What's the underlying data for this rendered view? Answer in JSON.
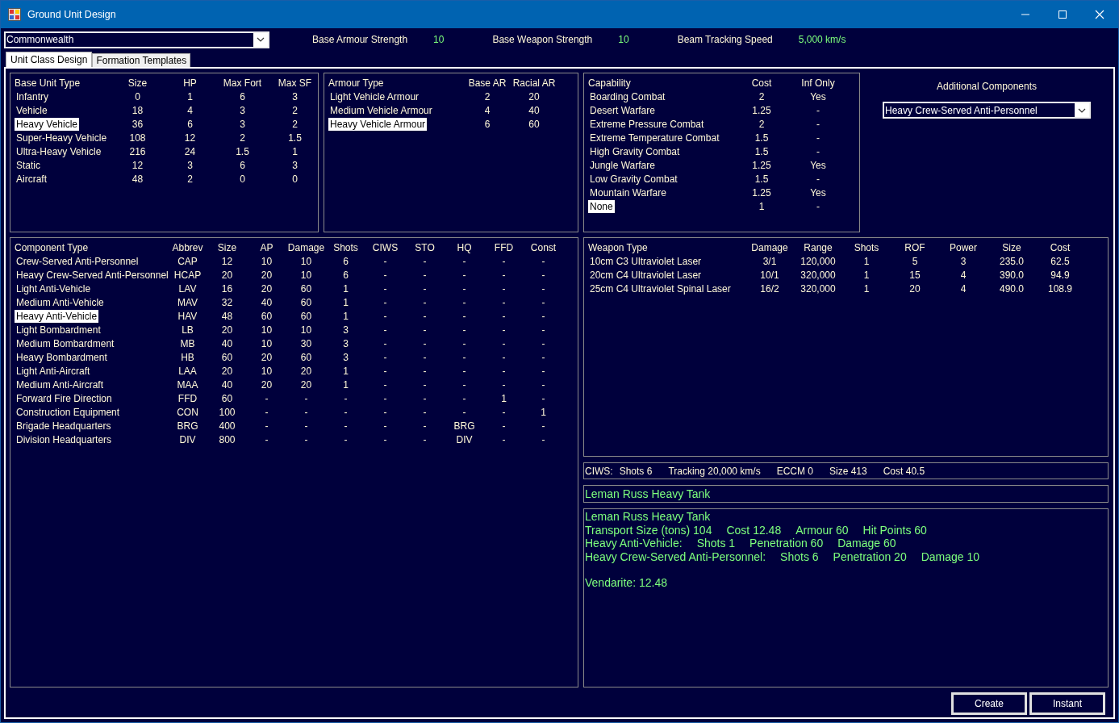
{
  "window": {
    "title": "Ground Unit Design"
  },
  "empire_select": {
    "value": "Commonwealth"
  },
  "stats": [
    {
      "label": "Base Armour Strength",
      "value": "10"
    },
    {
      "label": "Base Weapon Strength",
      "value": "10"
    },
    {
      "label": "Beam Tracking Speed",
      "value": "5,000 km/s"
    }
  ],
  "tabs": [
    {
      "label": "Unit Class Design",
      "selected": true
    },
    {
      "label": "Formation Templates",
      "selected": false
    }
  ],
  "base_unit_table": {
    "columns": [
      "Base Unit Type",
      "Size",
      "HP",
      "Max Fort",
      "Max SF"
    ],
    "rows": [
      {
        "cells": [
          "Infantry",
          "0",
          "1",
          "6",
          "3"
        ],
        "selected": false
      },
      {
        "cells": [
          "Vehicle",
          "18",
          "4",
          "3",
          "2"
        ],
        "selected": false
      },
      {
        "cells": [
          "Heavy Vehicle",
          "36",
          "6",
          "3",
          "2"
        ],
        "selected": true
      },
      {
        "cells": [
          "Super-Heavy Vehicle",
          "108",
          "12",
          "2",
          "1.5"
        ],
        "selected": false
      },
      {
        "cells": [
          "Ultra-Heavy Vehicle",
          "216",
          "24",
          "1.5",
          "1"
        ],
        "selected": false
      },
      {
        "cells": [
          "Static",
          "12",
          "3",
          "6",
          "3"
        ],
        "selected": false
      },
      {
        "cells": [
          "Aircraft",
          "48",
          "2",
          "0",
          "0"
        ],
        "selected": false
      }
    ]
  },
  "armour_table": {
    "columns": [
      "Armour Type",
      "Base AR",
      "Racial AR"
    ],
    "rows": [
      {
        "cells": [
          "Light Vehicle Armour",
          "2",
          "20"
        ],
        "selected": false
      },
      {
        "cells": [
          "Medium Vehicle Armour",
          "4",
          "40"
        ],
        "selected": false
      },
      {
        "cells": [
          "Heavy Vehicle Armour",
          "6",
          "60"
        ],
        "selected": true
      }
    ]
  },
  "capability_table": {
    "columns": [
      "Capability",
      "Cost",
      "Inf Only"
    ],
    "rows": [
      {
        "cells": [
          "Boarding Combat",
          "2",
          "Yes"
        ],
        "selected": false
      },
      {
        "cells": [
          "Desert Warfare",
          "1.25",
          "-"
        ],
        "selected": false
      },
      {
        "cells": [
          "Extreme Pressure Combat",
          "2",
          "-"
        ],
        "selected": false
      },
      {
        "cells": [
          "Extreme Temperature Combat",
          "1.5",
          "-"
        ],
        "selected": false
      },
      {
        "cells": [
          "High Gravity Combat",
          "1.5",
          "-"
        ],
        "selected": false
      },
      {
        "cells": [
          "Jungle Warfare",
          "1.25",
          "Yes"
        ],
        "selected": false
      },
      {
        "cells": [
          "Low Gravity Combat",
          "1.5",
          "-"
        ],
        "selected": false
      },
      {
        "cells": [
          "Mountain Warfare",
          "1.25",
          "Yes"
        ],
        "selected": false
      },
      {
        "cells": [
          "None",
          "1",
          "-"
        ],
        "selected": true
      }
    ]
  },
  "additional_components": {
    "label": "Additional Components",
    "value": "Heavy Crew-Served Anti-Personnel"
  },
  "component_table": {
    "columns": [
      "Component Type",
      "Abbrev",
      "Size",
      "AP",
      "Damage",
      "Shots",
      "CIWS",
      "STO",
      "HQ",
      "FFD",
      "Const"
    ],
    "rows": [
      {
        "cells": [
          "Crew-Served Anti-Personnel",
          "CAP",
          "12",
          "10",
          "10",
          "6",
          "-",
          "-",
          "-",
          "-",
          "-"
        ],
        "selected": false
      },
      {
        "cells": [
          "Heavy Crew-Served Anti-Personnel",
          "HCAP",
          "20",
          "20",
          "10",
          "6",
          "-",
          "-",
          "-",
          "-",
          "-"
        ],
        "selected": false
      },
      {
        "cells": [
          "Light Anti-Vehicle",
          "LAV",
          "16",
          "20",
          "60",
          "1",
          "-",
          "-",
          "-",
          "-",
          "-"
        ],
        "selected": false
      },
      {
        "cells": [
          "Medium Anti-Vehicle",
          "MAV",
          "32",
          "40",
          "60",
          "1",
          "-",
          "-",
          "-",
          "-",
          "-"
        ],
        "selected": false
      },
      {
        "cells": [
          "Heavy Anti-Vehicle",
          "HAV",
          "48",
          "60",
          "60",
          "1",
          "-",
          "-",
          "-",
          "-",
          "-"
        ],
        "selected": true
      },
      {
        "cells": [
          "Light Bombardment",
          "LB",
          "20",
          "10",
          "10",
          "3",
          "-",
          "-",
          "-",
          "-",
          "-"
        ],
        "selected": false
      },
      {
        "cells": [
          "Medium Bombardment",
          "MB",
          "40",
          "10",
          "30",
          "3",
          "-",
          "-",
          "-",
          "-",
          "-"
        ],
        "selected": false
      },
      {
        "cells": [
          "Heavy Bombardment",
          "HB",
          "60",
          "20",
          "60",
          "3",
          "-",
          "-",
          "-",
          "-",
          "-"
        ],
        "selected": false
      },
      {
        "cells": [
          "Light Anti-Aircraft",
          "LAA",
          "20",
          "10",
          "20",
          "1",
          "-",
          "-",
          "-",
          "-",
          "-"
        ],
        "selected": false
      },
      {
        "cells": [
          "Medium Anti-Aircraft",
          "MAA",
          "40",
          "20",
          "20",
          "1",
          "-",
          "-",
          "-",
          "-",
          "-"
        ],
        "selected": false
      },
      {
        "cells": [
          "Forward Fire Direction",
          "FFD",
          "60",
          "-",
          "-",
          "-",
          "-",
          "-",
          "-",
          "1",
          "-"
        ],
        "selected": false
      },
      {
        "cells": [
          "Construction Equipment",
          "CON",
          "100",
          "-",
          "-",
          "-",
          "-",
          "-",
          "-",
          "-",
          "1"
        ],
        "selected": false
      },
      {
        "cells": [
          "Brigade Headquarters",
          "BRG",
          "400",
          "-",
          "-",
          "-",
          "-",
          "-",
          "BRG",
          "-",
          "-"
        ],
        "selected": false
      },
      {
        "cells": [
          "Division Headquarters",
          "DIV",
          "800",
          "-",
          "-",
          "-",
          "-",
          "-",
          "DIV",
          "-",
          "-"
        ],
        "selected": false
      }
    ]
  },
  "weapon_table": {
    "columns": [
      "Weapon Type",
      "Damage",
      "Range",
      "Shots",
      "ROF",
      "Power",
      "Size",
      "Cost"
    ],
    "rows": [
      {
        "cells": [
          "10cm C3 Ultraviolet Laser",
          "3/1",
          "120,000",
          "1",
          "5",
          "3",
          "235.0",
          "62.5"
        ],
        "selected": false
      },
      {
        "cells": [
          "20cm C4 Ultraviolet Laser",
          "10/1",
          "320,000",
          "1",
          "15",
          "4",
          "390.0",
          "94.9"
        ],
        "selected": false
      },
      {
        "cells": [
          "25cm C4 Ultraviolet Spinal Laser",
          "16/2",
          "320,000",
          "1",
          "20",
          "4",
          "490.0",
          "108.9"
        ],
        "selected": false
      }
    ]
  },
  "ciws": {
    "label": "CIWS:",
    "items": [
      "Shots 6",
      "Tracking 20,000 km/s",
      "ECCM 0",
      "Size 413",
      "Cost 40.5"
    ]
  },
  "design_name": {
    "value": "Leman Russ Heavy Tank"
  },
  "summary": {
    "blocks": [
      {
        "lines": [
          [
            "Leman Russ Heavy Tank"
          ],
          [
            "Transport Size (tons) 104",
            "Cost 12.48",
            "Armour 60",
            "Hit Points 60"
          ],
          [
            "Heavy Anti-Vehicle:",
            "Shots 1",
            "Penetration 60",
            "Damage 60"
          ],
          [
            "Heavy Crew-Served Anti-Personnel:",
            "Shots 6",
            "Penetration 20",
            "Damage 10"
          ]
        ]
      },
      {
        "lines": [
          [
            "Vendarite: 12.48"
          ]
        ]
      }
    ]
  },
  "buttons": [
    "Create",
    "Instant"
  ]
}
